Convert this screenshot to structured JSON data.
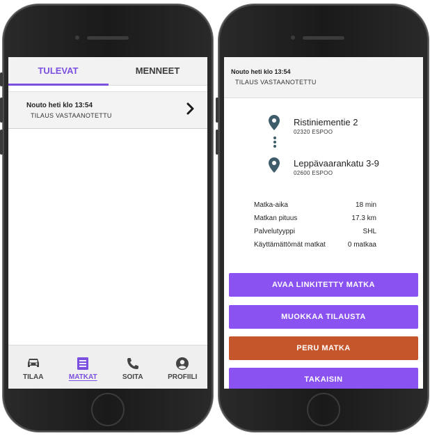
{
  "colors": {
    "accent": "#7b4fe0",
    "button": "#8a52f0",
    "cancel": "#c5562b",
    "pin": "#3e5c6a"
  },
  "left_screen": {
    "tabs": [
      {
        "label": "TULEVAT",
        "active": true
      },
      {
        "label": "MENNEET",
        "active": false
      }
    ],
    "trip": {
      "time": "Nouto heti klo 13:54",
      "status": "TILAUS VASTAANOTETTU",
      "icon": "chevron-right-icon"
    },
    "nav": [
      {
        "label": "TILAA",
        "icon": "car-icon",
        "active": false
      },
      {
        "label": "MATKAT",
        "icon": "list-icon",
        "active": true
      },
      {
        "label": "SOITA",
        "icon": "phone-icon",
        "active": false
      },
      {
        "label": "PROFIILI",
        "icon": "user-icon",
        "active": false
      }
    ]
  },
  "right_screen": {
    "header": {
      "time": "Nouto heti klo 13:54",
      "status": "TILAUS VASTAANOTETTU"
    },
    "pickup": {
      "street": "Ristiniementie 2",
      "postal": "02320  ESPOO",
      "icon": "location-pin-icon"
    },
    "dropoff": {
      "street": "Leppävaarankatu 3-9",
      "postal": "02600  ESPOO",
      "icon": "location-pin-icon"
    },
    "info": [
      {
        "label": "Matka-aika",
        "value": "18 min"
      },
      {
        "label": "Matkan pituus",
        "value": "17.3 km"
      },
      {
        "label": "Palvelutyyppi",
        "value": "SHL"
      },
      {
        "label": "Käyttämättömät matkat",
        "value": "0 matkaa"
      }
    ],
    "buttons": {
      "open_linked": "AVAA LINKITETTY MATKA",
      "edit_order": "MUOKKAA TILAUSTA",
      "cancel_trip": "PERU MATKA",
      "back": "TAKAISIN"
    }
  }
}
